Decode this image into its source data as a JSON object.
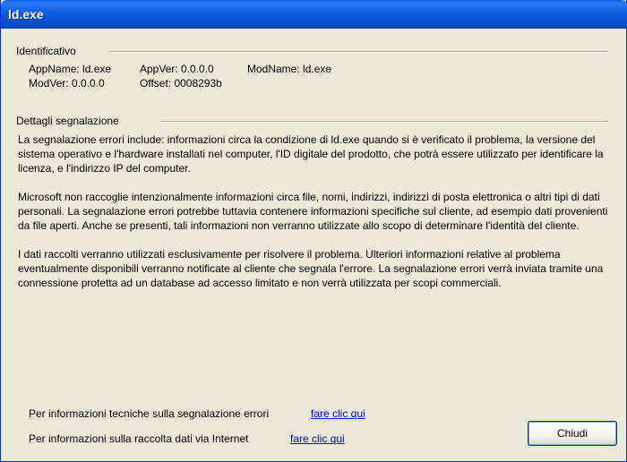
{
  "window": {
    "title": "ld.exe"
  },
  "identification": {
    "label": "Identificativo",
    "app_name": "AppName: ld.exe",
    "app_ver": "AppVer: 0.0.0.0",
    "mod_name": "ModName: ld.exe",
    "mod_ver": "ModVer: 0.0.0.0",
    "offset": "Offset: 0008293b"
  },
  "details": {
    "label": "Dettagli segnalazione",
    "paragraph_1": "La segnalazione errori include: informazioni circa la condizione di ld.exe quando si è verificato il problema, la versione del sistema operativo e l'hardware installati nel computer, l'ID digitale del prodotto, che potrà essere utilizzato per identificare la licenza, e l'indirizzo IP del computer.",
    "paragraph_2": "Microsoft non raccoglie intenzionalmente informazioni circa file, nomi, indirizzi, indirizzi di posta elettronica o altri tipi di dati personali. La segnalazione errori potrebbe tuttavia contenere informazioni specifiche sul cliente, ad esempio dati provenienti da file aperti. Anche se presenti, tali informazioni non verranno utilizzate allo scopo di determinare l'identità del cliente.",
    "paragraph_3": "I dati raccolti verranno utilizzati esclusivamente per risolvere il problema. Ulteriori informazioni relative al problema eventualmente disponibili verranno notificate al cliente che segnala l'errore. La segnalazione errori verrà inviata tramite una connessione protetta ad un database ad accesso limitato e non verrà utilizzata per scopi commerciali."
  },
  "links": {
    "technical_label": "Per informazioni tecniche sulla segnalazione errori",
    "technical_link": "fare clic qui",
    "internet_label": "Per informazioni sulla raccolta dati via Internet",
    "internet_link": "fare clic qui"
  },
  "buttons": {
    "close": "Chiudi"
  }
}
